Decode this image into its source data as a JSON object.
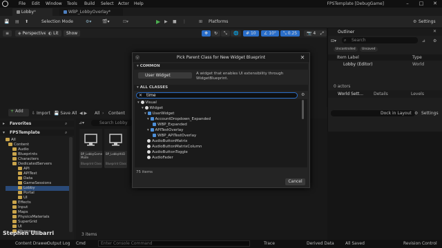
{
  "menubar": {
    "items": [
      "File",
      "Edit",
      "Window",
      "Tools",
      "Build",
      "Select",
      "Actor",
      "Help"
    ],
    "window_title": "FPSTemplate [DebugGame]"
  },
  "tabs": {
    "level_tab": "Lobby",
    "widget_tab": "WBP_LobbyOverlay"
  },
  "toolbar": {
    "selection_mode": "Selection Mode",
    "platforms": "Platforms",
    "settings": "Settings"
  },
  "viewport": {
    "perspective": "Perspective",
    "lit": "Lit",
    "show": "Show",
    "grid_value": "10",
    "angle_value": "10°",
    "scale_value": "0.25",
    "camera_value": "4"
  },
  "outliner": {
    "title": "Outliner",
    "search_placeholder": "Search",
    "filter_uncontrolled": "Uncontrolled",
    "filter_unsaved": "Unsaved",
    "col_item": "Item Label",
    "col_type": "Type",
    "row_label": "Lobby (Editor)",
    "row_type": "World",
    "actors": "0 actors"
  },
  "details": {
    "tab_world": "World Sett...",
    "tab_details": "Details",
    "tab_levels": "Levels"
  },
  "content_browser": {
    "add": "Add",
    "import": "Import",
    "save_all": "Save All",
    "path_all": "All",
    "path_content": "Content",
    "search_placeholder": "Search Lobby",
    "favorites": "Favorites",
    "project": "FPSTemplate",
    "dock": "Dock in Layout",
    "settings": "Settings",
    "items_count": "3 items",
    "tree": [
      "All",
      "Content",
      "Audio",
      "Blueprints",
      "Characters",
      "DedicatedServers",
      "API",
      "APITest",
      "Data",
      "GameSessions",
      "Lobby",
      "Portal",
      "UI",
      "Effects",
      "Input",
      "Maps",
      "PhysicsMaterials",
      "SuperGrid",
      "UI",
      "Weapons"
    ],
    "assets": [
      {
        "name": "BP_LobbyGame Mode",
        "type": "Blueprint Class"
      },
      {
        "name": "BP_LobbyHUD",
        "type": "Blueprint Class"
      }
    ]
  },
  "statusbar": {
    "content_drawer": "Content Drawer",
    "output_log": "Output Log",
    "cmd": "Cmd",
    "console_placeholder": "Enter Console Command",
    "trace": "Trace",
    "derived_data": "Derived Data",
    "all_saved": "All Saved",
    "revision_control": "Revision Control"
  },
  "watermark": "Stephen Ulibarri",
  "modal": {
    "title": "Pick Parent Class for New Widget Blueprint",
    "common_header": "COMMON",
    "user_widget": "User Widget",
    "user_widget_desc": "A widget that enables UI extensibility through WidgetBlueprint.",
    "all_classes_header": "ALL CLASSES",
    "filter_value": "time",
    "items_count": "75 items",
    "cancel": "Cancel",
    "classes": [
      "Visual",
      "Widget",
      "UserWidget",
      "AccountDropdown_Expanded",
      "WBP_Expanded",
      "APITestOverlay",
      "WBP_APITestOverlay",
      "AudioButtonMatrix",
      "AudioButtonMatrixColumn",
      "AudioButtonToggle",
      "AudioFader"
    ]
  }
}
